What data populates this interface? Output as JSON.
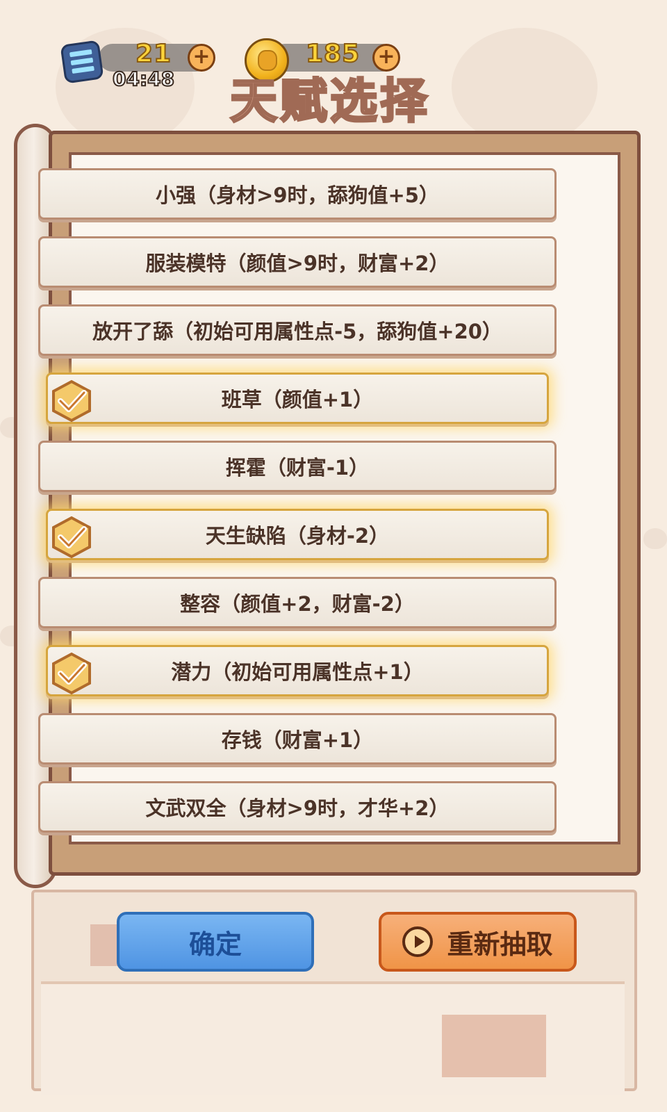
{
  "hud": {
    "energy": "21",
    "timer": "04:48",
    "coins": "185",
    "plus": "+"
  },
  "title": "天赋选择",
  "talents": [
    {
      "label": "小强（身材>9时，舔狗值+5）",
      "selected": false
    },
    {
      "label": "服装模特（颜值>9时，财富+2）",
      "selected": false
    },
    {
      "label": "放开了舔（初始可用属性点-5，舔狗值+20）",
      "selected": false
    },
    {
      "label": "班草（颜值+1）",
      "selected": true
    },
    {
      "label": "挥霍（财富-1）",
      "selected": false
    },
    {
      "label": "天生缺陷（身材-2）",
      "selected": true
    },
    {
      "label": "整容（颜值+2，财富-2）",
      "selected": false
    },
    {
      "label": "潜力（初始可用属性点+1）",
      "selected": true
    },
    {
      "label": "存钱（财富+1）",
      "selected": false
    },
    {
      "label": "文武双全（身材>9时，才华+2）",
      "selected": false
    }
  ],
  "buttons": {
    "confirm": "确定",
    "redraw": "重新抽取"
  },
  "icons": {
    "energy": "battery-icon",
    "coin": "dog-coin-icon",
    "check": "checkmark-badge-icon",
    "play": "play-circle-icon"
  },
  "colors": {
    "background": "#f7ece0",
    "book_frame": "#7e4f3e",
    "confirm_button": "#4f94e3",
    "redraw_button": "#f09447",
    "selected_glow": "#ffd76e"
  }
}
